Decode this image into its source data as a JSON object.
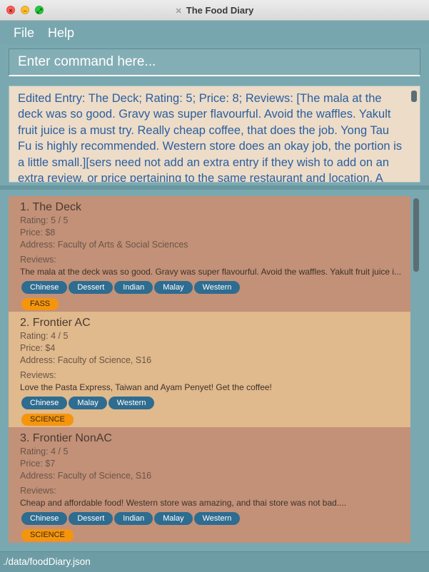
{
  "window": {
    "title": "The Food Diary"
  },
  "menu": {
    "file": "File",
    "help": "Help"
  },
  "command": {
    "placeholder": "Enter command here..."
  },
  "result": {
    "text": "Edited Entry: The Deck; Rating: 5; Price: 8; Reviews: [The mala at the deck was so good. Gravy was super flavourful. Avoid the waffles.  Yakult fruit juice is a must try. Really cheap coffee, that does the job. Yong Tau Fu is highly recommended. Western store does an okay job, the portion is a little small.][sers need not add an extra entry if they wish to add on an extra review, or price pertaining to the same restaurant and location. A common"
  },
  "entries": [
    {
      "title": "1.  The Deck",
      "rating": "Rating: 5 / 5",
      "price": "Price: $8",
      "address": "Address: Faculty of Arts & Social Sciences",
      "reviews_label": "Reviews:",
      "review": "The mala at the deck was so good. Gravy was super flavourful. Avoid the waffles.  Yakult fruit juice i...",
      "tags": [
        "Chinese",
        "Dessert",
        "Indian",
        "Malay",
        "Western"
      ],
      "location": "FASS"
    },
    {
      "title": "2.  Frontier AC",
      "rating": "Rating: 4 / 5",
      "price": "Price: $4",
      "address": "Address: Faculty of Science, S16",
      "reviews_label": "Reviews:",
      "review": "Love the Pasta Express, Taiwan and Ayam Penyet! Get the coffee!",
      "tags": [
        "Chinese",
        "Malay",
        "Western"
      ],
      "location": "SCIENCE"
    },
    {
      "title": "3.  Frontier NonAC",
      "rating": "Rating: 4 / 5",
      "price": "Price: $7",
      "address": "Address: Faculty of Science, S16",
      "reviews_label": "Reviews:",
      "review": "Cheap and affordable food! Western store was amazing, and thai store was not bad....",
      "tags": [
        "Chinese",
        "Dessert",
        "Indian",
        "Malay",
        "Western"
      ],
      "location": "SCIENCE"
    }
  ],
  "status": {
    "path": "./data/foodDiary.json"
  },
  "colors": {
    "background": "#7aa8b0",
    "card_dark": "#c29178",
    "card_light": "#e0b98c",
    "tag": "#2e6c90",
    "location_tag": "#f5950e",
    "result_text": "#2a5fa0",
    "result_bg": "#eddcc8"
  }
}
